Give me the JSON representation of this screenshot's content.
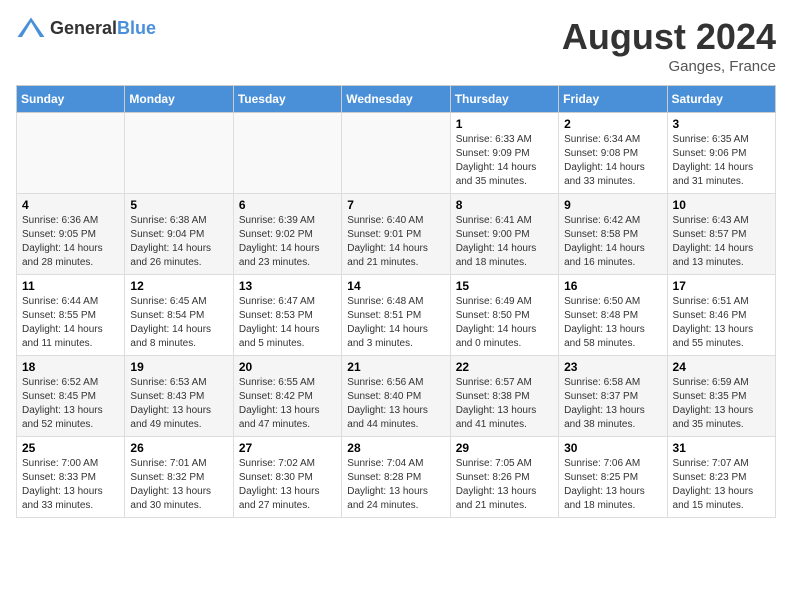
{
  "logo": {
    "general": "General",
    "blue": "Blue"
  },
  "title": {
    "month_year": "August 2024",
    "location": "Ganges, France"
  },
  "days_of_week": [
    "Sunday",
    "Monday",
    "Tuesday",
    "Wednesday",
    "Thursday",
    "Friday",
    "Saturday"
  ],
  "weeks": [
    [
      {
        "day": "",
        "info": ""
      },
      {
        "day": "",
        "info": ""
      },
      {
        "day": "",
        "info": ""
      },
      {
        "day": "",
        "info": ""
      },
      {
        "day": "1",
        "info": "Sunrise: 6:33 AM\nSunset: 9:09 PM\nDaylight: 14 hours\nand 35 minutes."
      },
      {
        "day": "2",
        "info": "Sunrise: 6:34 AM\nSunset: 9:08 PM\nDaylight: 14 hours\nand 33 minutes."
      },
      {
        "day": "3",
        "info": "Sunrise: 6:35 AM\nSunset: 9:06 PM\nDaylight: 14 hours\nand 31 minutes."
      }
    ],
    [
      {
        "day": "4",
        "info": "Sunrise: 6:36 AM\nSunset: 9:05 PM\nDaylight: 14 hours\nand 28 minutes."
      },
      {
        "day": "5",
        "info": "Sunrise: 6:38 AM\nSunset: 9:04 PM\nDaylight: 14 hours\nand 26 minutes."
      },
      {
        "day": "6",
        "info": "Sunrise: 6:39 AM\nSunset: 9:02 PM\nDaylight: 14 hours\nand 23 minutes."
      },
      {
        "day": "7",
        "info": "Sunrise: 6:40 AM\nSunset: 9:01 PM\nDaylight: 14 hours\nand 21 minutes."
      },
      {
        "day": "8",
        "info": "Sunrise: 6:41 AM\nSunset: 9:00 PM\nDaylight: 14 hours\nand 18 minutes."
      },
      {
        "day": "9",
        "info": "Sunrise: 6:42 AM\nSunset: 8:58 PM\nDaylight: 14 hours\nand 16 minutes."
      },
      {
        "day": "10",
        "info": "Sunrise: 6:43 AM\nSunset: 8:57 PM\nDaylight: 14 hours\nand 13 minutes."
      }
    ],
    [
      {
        "day": "11",
        "info": "Sunrise: 6:44 AM\nSunset: 8:55 PM\nDaylight: 14 hours\nand 11 minutes."
      },
      {
        "day": "12",
        "info": "Sunrise: 6:45 AM\nSunset: 8:54 PM\nDaylight: 14 hours\nand 8 minutes."
      },
      {
        "day": "13",
        "info": "Sunrise: 6:47 AM\nSunset: 8:53 PM\nDaylight: 14 hours\nand 5 minutes."
      },
      {
        "day": "14",
        "info": "Sunrise: 6:48 AM\nSunset: 8:51 PM\nDaylight: 14 hours\nand 3 minutes."
      },
      {
        "day": "15",
        "info": "Sunrise: 6:49 AM\nSunset: 8:50 PM\nDaylight: 14 hours\nand 0 minutes."
      },
      {
        "day": "16",
        "info": "Sunrise: 6:50 AM\nSunset: 8:48 PM\nDaylight: 13 hours\nand 58 minutes."
      },
      {
        "day": "17",
        "info": "Sunrise: 6:51 AM\nSunset: 8:46 PM\nDaylight: 13 hours\nand 55 minutes."
      }
    ],
    [
      {
        "day": "18",
        "info": "Sunrise: 6:52 AM\nSunset: 8:45 PM\nDaylight: 13 hours\nand 52 minutes."
      },
      {
        "day": "19",
        "info": "Sunrise: 6:53 AM\nSunset: 8:43 PM\nDaylight: 13 hours\nand 49 minutes."
      },
      {
        "day": "20",
        "info": "Sunrise: 6:55 AM\nSunset: 8:42 PM\nDaylight: 13 hours\nand 47 minutes."
      },
      {
        "day": "21",
        "info": "Sunrise: 6:56 AM\nSunset: 8:40 PM\nDaylight: 13 hours\nand 44 minutes."
      },
      {
        "day": "22",
        "info": "Sunrise: 6:57 AM\nSunset: 8:38 PM\nDaylight: 13 hours\nand 41 minutes."
      },
      {
        "day": "23",
        "info": "Sunrise: 6:58 AM\nSunset: 8:37 PM\nDaylight: 13 hours\nand 38 minutes."
      },
      {
        "day": "24",
        "info": "Sunrise: 6:59 AM\nSunset: 8:35 PM\nDaylight: 13 hours\nand 35 minutes."
      }
    ],
    [
      {
        "day": "25",
        "info": "Sunrise: 7:00 AM\nSunset: 8:33 PM\nDaylight: 13 hours\nand 33 minutes."
      },
      {
        "day": "26",
        "info": "Sunrise: 7:01 AM\nSunset: 8:32 PM\nDaylight: 13 hours\nand 30 minutes."
      },
      {
        "day": "27",
        "info": "Sunrise: 7:02 AM\nSunset: 8:30 PM\nDaylight: 13 hours\nand 27 minutes."
      },
      {
        "day": "28",
        "info": "Sunrise: 7:04 AM\nSunset: 8:28 PM\nDaylight: 13 hours\nand 24 minutes."
      },
      {
        "day": "29",
        "info": "Sunrise: 7:05 AM\nSunset: 8:26 PM\nDaylight: 13 hours\nand 21 minutes."
      },
      {
        "day": "30",
        "info": "Sunrise: 7:06 AM\nSunset: 8:25 PM\nDaylight: 13 hours\nand 18 minutes."
      },
      {
        "day": "31",
        "info": "Sunrise: 7:07 AM\nSunset: 8:23 PM\nDaylight: 13 hours\nand 15 minutes."
      }
    ]
  ]
}
